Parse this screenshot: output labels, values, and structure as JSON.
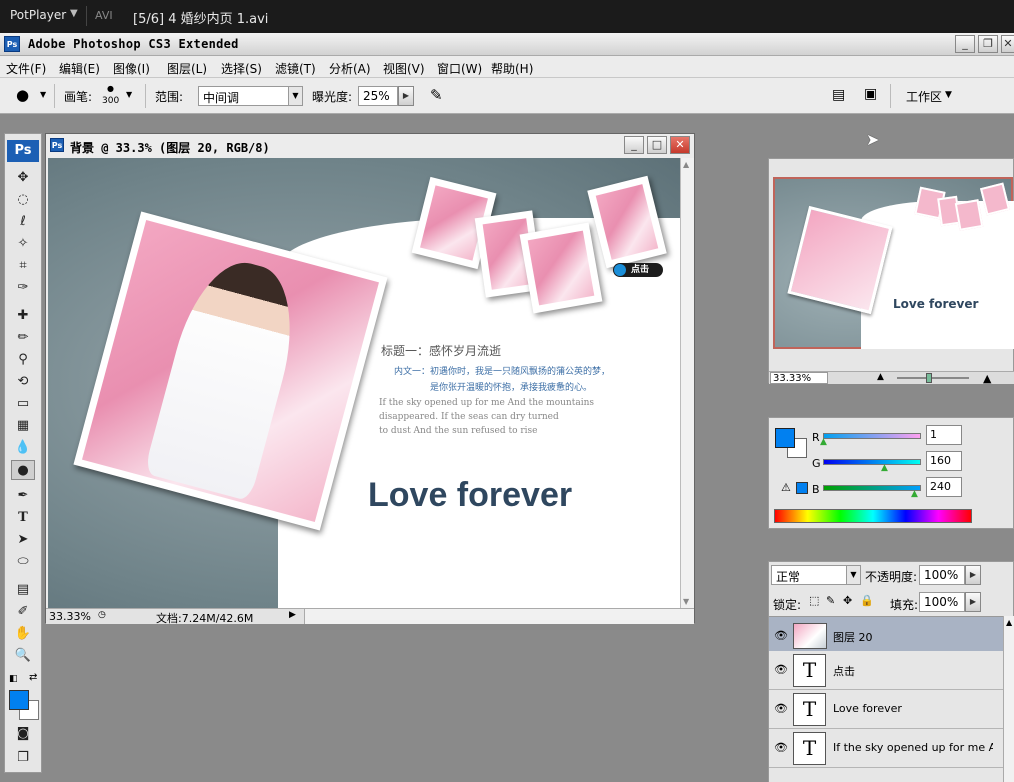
{
  "player": {
    "brand": "PotPlayer",
    "format": "AVI",
    "file": "[5/6] 4 婚纱内页 1.avi"
  },
  "app": {
    "title": "Adobe Photoshop CS3 Extended",
    "icon_label": "Ps"
  },
  "menu": [
    "文件(F)",
    "编辑(E)",
    "图像(I)",
    "图层(L)",
    "选择(S)",
    "滤镜(T)",
    "分析(A)",
    "视图(V)",
    "窗口(W)",
    "帮助(H)"
  ],
  "options": {
    "brush_label": "画笔:",
    "brush_size": "300",
    "range_label": "范围:",
    "range_value": "中间调",
    "exposure_label": "曝光度:",
    "exposure_value": "25%",
    "workspace": "工作区"
  },
  "document": {
    "title": "背景 @ 33.3% (图层 20, RGB/8)",
    "zoom": "33.33%",
    "doc_info": "文档:7.24M/42.6M",
    "artwork": {
      "heading": "标题一：感怀岁月流逝",
      "line1": "内文一：初遇你时，我是一只随风飘扬的蒲公英的梦，",
      "line2": "是你张开温暖的怀抱，承接我疲惫的心。",
      "english1": "If the sky opened up for me And the mountains",
      "english2": "disappeared. If the seas can dry turned",
      "english3": "to dust And the sun refused to rise",
      "love": "Love forever",
      "click_label": "点击"
    }
  },
  "navigator": {
    "zoom": "33.33%",
    "mini_love": "Love forever"
  },
  "color": {
    "fg": "#0180f0",
    "r_label": "R",
    "g_label": "G",
    "b_label": "B",
    "r": "1",
    "g": "160",
    "b": "240"
  },
  "layers": {
    "blend_mode": "正常",
    "opacity_label": "不透明度:",
    "opacity": "100%",
    "lock_label": "锁定:",
    "fill_label": "填充:",
    "fill": "100%",
    "items": [
      {
        "name": "图层 20",
        "kind": "image"
      },
      {
        "name": "点击",
        "kind": "text"
      },
      {
        "name": "Love forever",
        "kind": "text"
      },
      {
        "name": "If the sky opened up for me A...",
        "kind": "text"
      }
    ]
  }
}
